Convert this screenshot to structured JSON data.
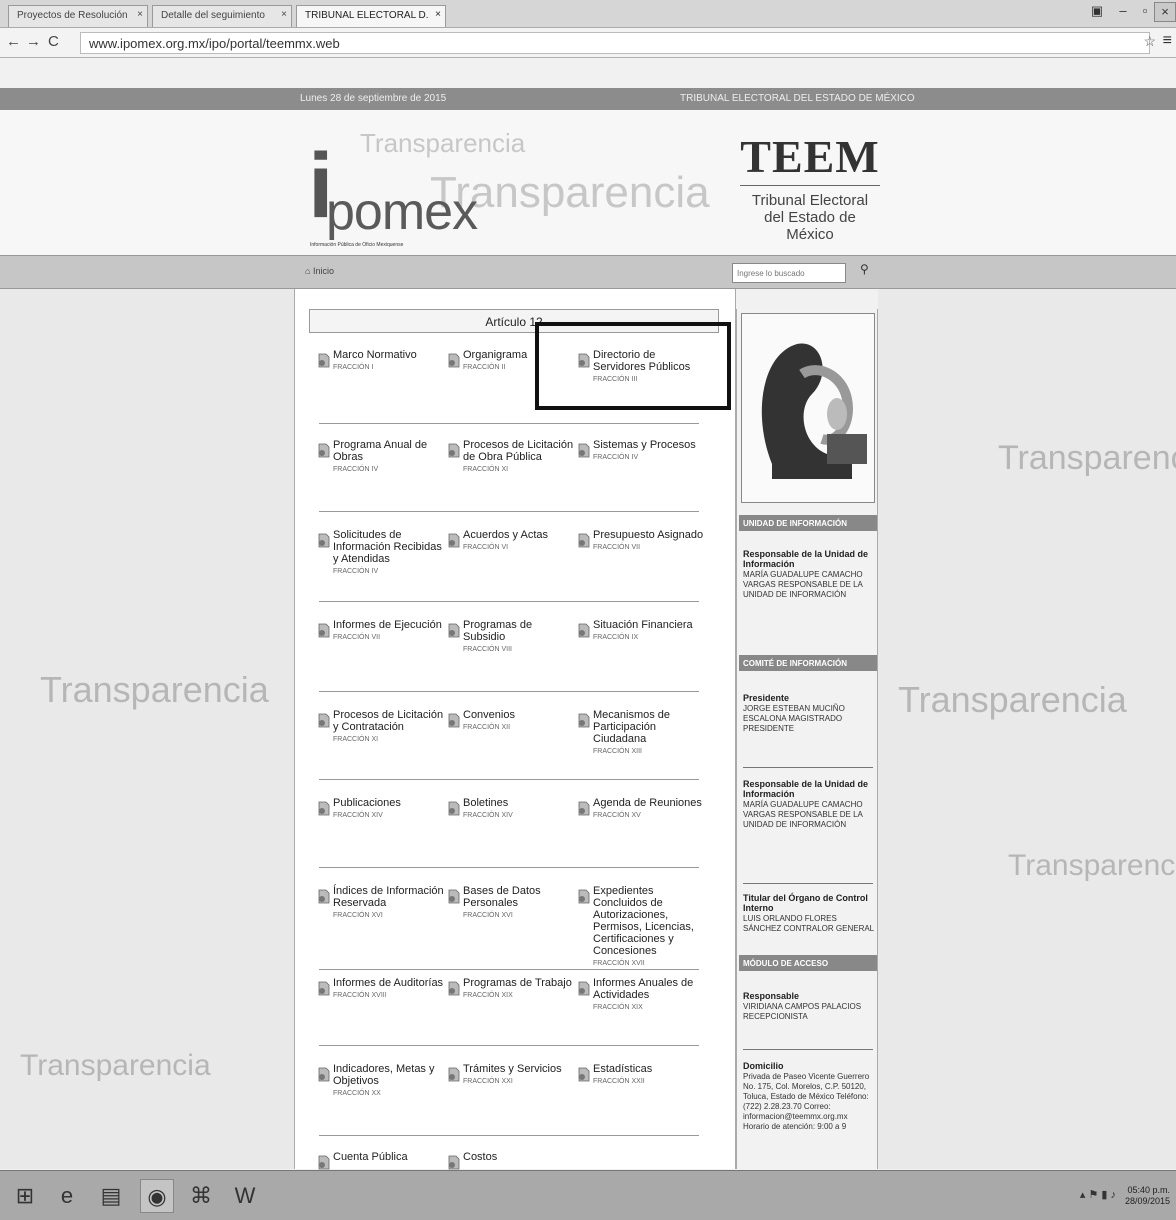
{
  "browser": {
    "tabs": [
      {
        "title": "Proyectos de Resolución"
      },
      {
        "title": "Detalle del seguimiento"
      },
      {
        "title": "TRIBUNAL ELECTORAL D."
      }
    ],
    "url": "www.ipomex.org.mx/ipo/portal/teemmx.web"
  },
  "top_strip": {
    "date": "Lunes 28 de septiembre de 2015",
    "org": "TRIBUNAL ELECTORAL DEL ESTADO DE MÉXICO"
  },
  "header": {
    "ipomex_i": "i",
    "ipomex_text": "pomex",
    "ipomex_sub": "Información Pública de Oficio Mexiquense",
    "ghost1": "Transparencia",
    "ghost2": "Transparencia",
    "teem_title": "TEEM",
    "teem_sub": "Tribunal Electoral del Estado de México"
  },
  "navbar": {
    "home": "Inicio",
    "search_placeholder": "Ingrese lo buscado"
  },
  "main": {
    "article_title": "Artículo 12",
    "items": [
      {
        "name": "Marco Normativo",
        "frac": "Fracción I"
      },
      {
        "name": "Organigrama",
        "frac": "Fracción II"
      },
      {
        "name": "Directorio de Servidores Públicos",
        "frac": "Fracción III"
      },
      {
        "name": "Programa Anual de Obras",
        "frac": "Fracción IV"
      },
      {
        "name": "Procesos de Licitación de Obra Pública",
        "frac": "Fracción XI"
      },
      {
        "name": "Sistemas y Procesos",
        "frac": "Fracción IV"
      },
      {
        "name": "Solicitudes de Información Recibidas y Atendidas",
        "frac": "Fracción IV"
      },
      {
        "name": "Acuerdos y Actas",
        "frac": "Fracción VI"
      },
      {
        "name": "Presupuesto Asignado",
        "frac": "Fracción VII"
      },
      {
        "name": "Informes de Ejecución",
        "frac": "Fracción VII"
      },
      {
        "name": "Programas de Subsidio",
        "frac": "Fracción VIII"
      },
      {
        "name": "Situación Financiera",
        "frac": "Fracción IX"
      },
      {
        "name": "Procesos de Licitación y Contratación",
        "frac": "Fracción XI"
      },
      {
        "name": "Convenios",
        "frac": "Fracción XII"
      },
      {
        "name": "Mecanismos de Participación Ciudadana",
        "frac": "Fracción XIII"
      },
      {
        "name": "Publicaciones",
        "frac": "Fracción XIV"
      },
      {
        "name": "Boletines",
        "frac": "Fracción XIV"
      },
      {
        "name": "Agenda de Reuniones",
        "frac": "Fracción XV"
      },
      {
        "name": "Índices de Información Reservada",
        "frac": "Fracción XVI"
      },
      {
        "name": "Bases de Datos Personales",
        "frac": "Fracción XVI"
      },
      {
        "name": "Expedientes Concluidos de Autorizaciones, Permisos, Licencias, Certificaciones y Concesiones",
        "frac": "Fracción XVII"
      },
      {
        "name": "Informes de Auditorías",
        "frac": "Fracción XVIII"
      },
      {
        "name": "Programas de Trabajo",
        "frac": "Fracción XIX"
      },
      {
        "name": "Informes Anuales de Actividades",
        "frac": "Fracción XIX"
      },
      {
        "name": "Indicadores, Metas y Objetivos",
        "frac": "Fracción XX"
      },
      {
        "name": "Trámites y Servicios",
        "frac": "Fracción XXI"
      },
      {
        "name": "Estadísticas",
        "frac": "Fracción XXII"
      },
      {
        "name": "Cuenta Pública",
        "frac": ""
      },
      {
        "name": "Costos",
        "frac": ""
      }
    ]
  },
  "right_panel": {
    "hdr1": "UNIDAD DE INFORMACIÓN",
    "b1_role": "Responsable de la Unidad de Información",
    "b1_text": "MARÍA GUADALUPE CAMACHO VARGAS RESPONSABLE DE LA UNIDAD DE INFORMACIÓN",
    "hdr2": "COMITÉ DE INFORMACIÓN",
    "b2_role": "Presidente",
    "b2_text": "JORGE ESTEBAN MUCIÑO ESCALONA MAGISTRADO PRESIDENTE",
    "b3_role": "Responsable de la Unidad de Información",
    "b3_text": "MARÍA GUADALUPE CAMACHO VARGAS RESPONSABLE DE LA UNIDAD DE INFORMACIÓN",
    "b4_role": "Titular del Órgano de Control Interno",
    "b4_text": "LUIS ORLANDO FLORES SÁNCHEZ CONTRALOR GENERAL",
    "hdr3": "MÓDULO DE ACCESO",
    "b5_role": "Responsable",
    "b5_text": "VIRIDIANA CAMPOS PALACIOS RECEPCIONISTA",
    "b6_role": "Domicilio",
    "b6_text": "Privada de Paseo Vicente Guerrero No. 175, Col. Morelos, C.P. 50120, Toluca, Estado de México Teléfono: (722) 2.28.23.70 Correo: informacion@teemmx.org.mx Horario de atención: 9:00 a 9"
  },
  "taskbar": {
    "time": "05:40 p.m.",
    "date": "28/09/2015"
  }
}
